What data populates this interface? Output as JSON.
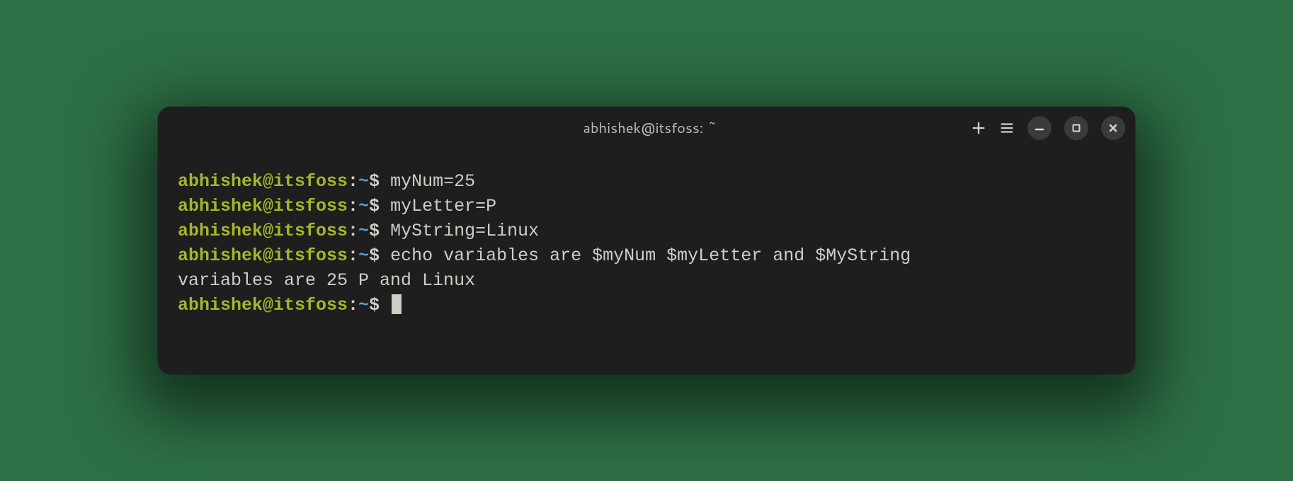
{
  "window": {
    "title": "abhishek@itsfoss: ~"
  },
  "prompt": {
    "user_host": "abhishek@itsfoss",
    "colon": ":",
    "path": "~",
    "symbol": "$"
  },
  "lines": [
    {
      "type": "cmd",
      "text": "myNum=25"
    },
    {
      "type": "cmd",
      "text": "myLetter=P"
    },
    {
      "type": "cmd",
      "text": "MyString=Linux"
    },
    {
      "type": "cmd",
      "text": "echo variables are $myNum $myLetter and $MyString"
    },
    {
      "type": "out",
      "text": "variables are 25 P and Linux"
    },
    {
      "type": "cursor",
      "text": ""
    }
  ]
}
